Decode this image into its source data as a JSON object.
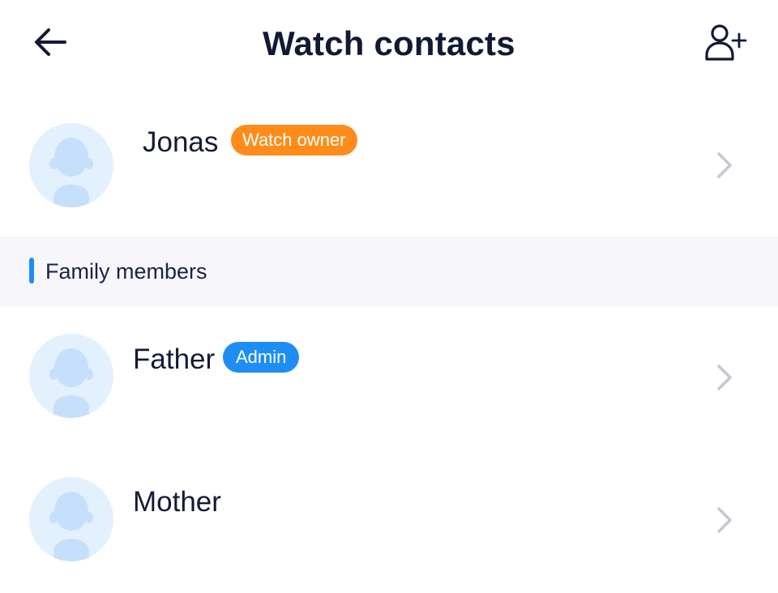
{
  "header": {
    "title": "Watch contacts",
    "back_icon": "arrow-left-icon",
    "add_icon": "add-user-icon"
  },
  "owner": {
    "name": "Jonas",
    "badge": "Watch owner",
    "badge_color": "#ff8c1a",
    "avatar_icon": "person-avatar-icon",
    "chevron_icon": "chevron-right-icon"
  },
  "family_section": {
    "title": "Family members",
    "accent_color": "#1e8ef5"
  },
  "members": [
    {
      "name": "Father",
      "badge": "Admin",
      "badge_color": "#1e8ef5",
      "avatar_icon": "person-avatar-icon",
      "chevron_icon": "chevron-right-icon"
    },
    {
      "name": "Mother",
      "avatar_icon": "person-avatar-icon",
      "chevron_icon": "chevron-right-icon"
    }
  ]
}
